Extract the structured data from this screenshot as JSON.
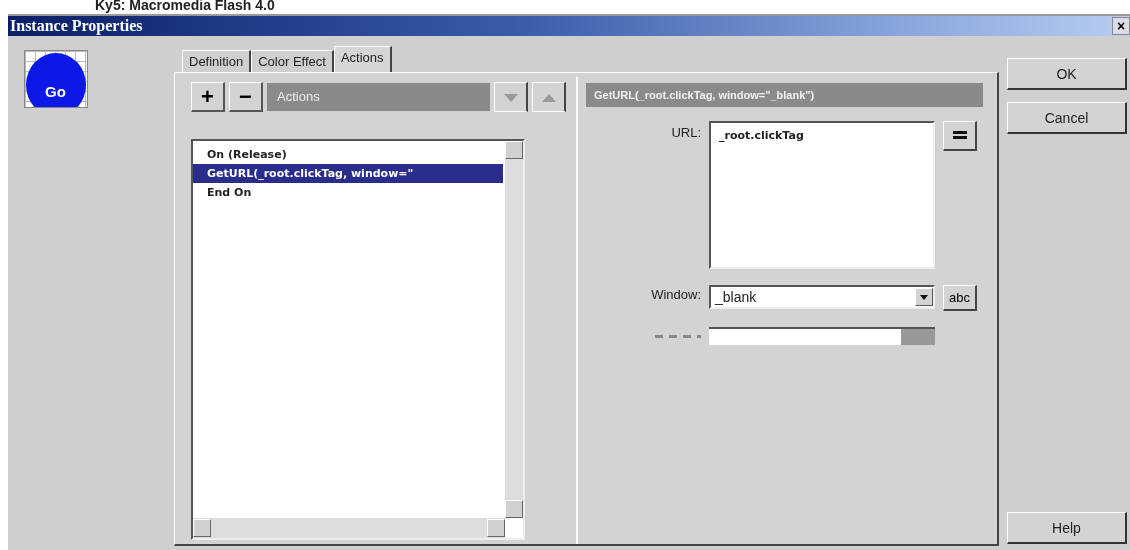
{
  "caption": "Ky5: Macromedia Flash 4.0",
  "window": {
    "title": "Instance Properties",
    "close": "×"
  },
  "preview": {
    "label": "Go"
  },
  "tabs": [
    {
      "label": "Definition",
      "selected": false
    },
    {
      "label": "Color Effect",
      "selected": false
    },
    {
      "label": "Actions",
      "selected": true
    }
  ],
  "toolbar": {
    "add": "+",
    "remove": "−",
    "dropdown": "Actions"
  },
  "script_lines": [
    {
      "text": "On (Release)",
      "selected": false
    },
    {
      "text": "GetURL(_root.clickTag, window=\"",
      "selected": true
    },
    {
      "text": "End On",
      "selected": false
    }
  ],
  "action_header": "GetURL(_root.clickTag, window=\"_blank\")",
  "url": {
    "label": "URL:",
    "value": "_root.clickTag"
  },
  "window_field": {
    "label": "Window:",
    "value": "_blank",
    "button": "abc"
  },
  "buttons": [
    {
      "label": "OK"
    },
    {
      "label": "Cancel"
    },
    {
      "label": "Help"
    }
  ]
}
